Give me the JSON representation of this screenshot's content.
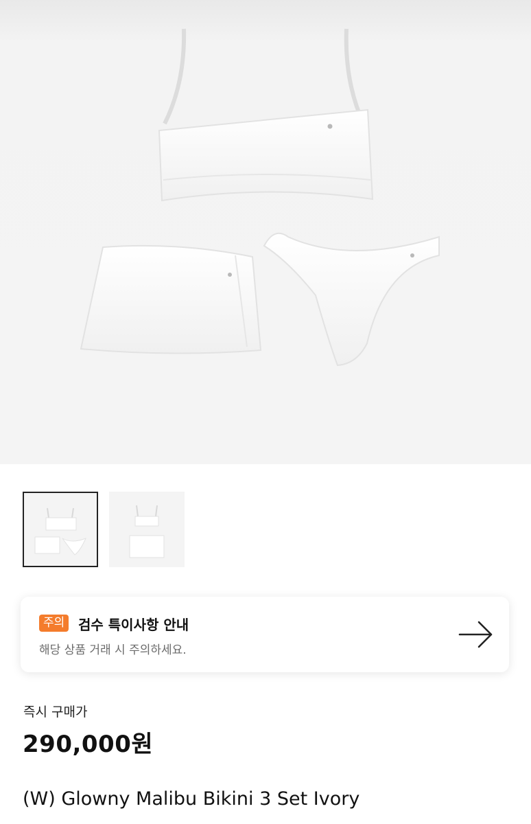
{
  "product_images": {
    "main_alt": "White bikini set: top, skirt and bottom",
    "thumbnails": [
      "thumbnail-1",
      "thumbnail-2"
    ]
  },
  "notice": {
    "badge": "주의",
    "title": "검수 특이사항 안내",
    "subtitle": "해당 상품 거래 시 주의하세요.",
    "accent_color": "#f47c2c"
  },
  "price": {
    "label": "즉시 구매가",
    "value": "290,000원"
  },
  "product": {
    "name": "(W) Glowny Malibu Bikini 3 Set Ivory"
  }
}
